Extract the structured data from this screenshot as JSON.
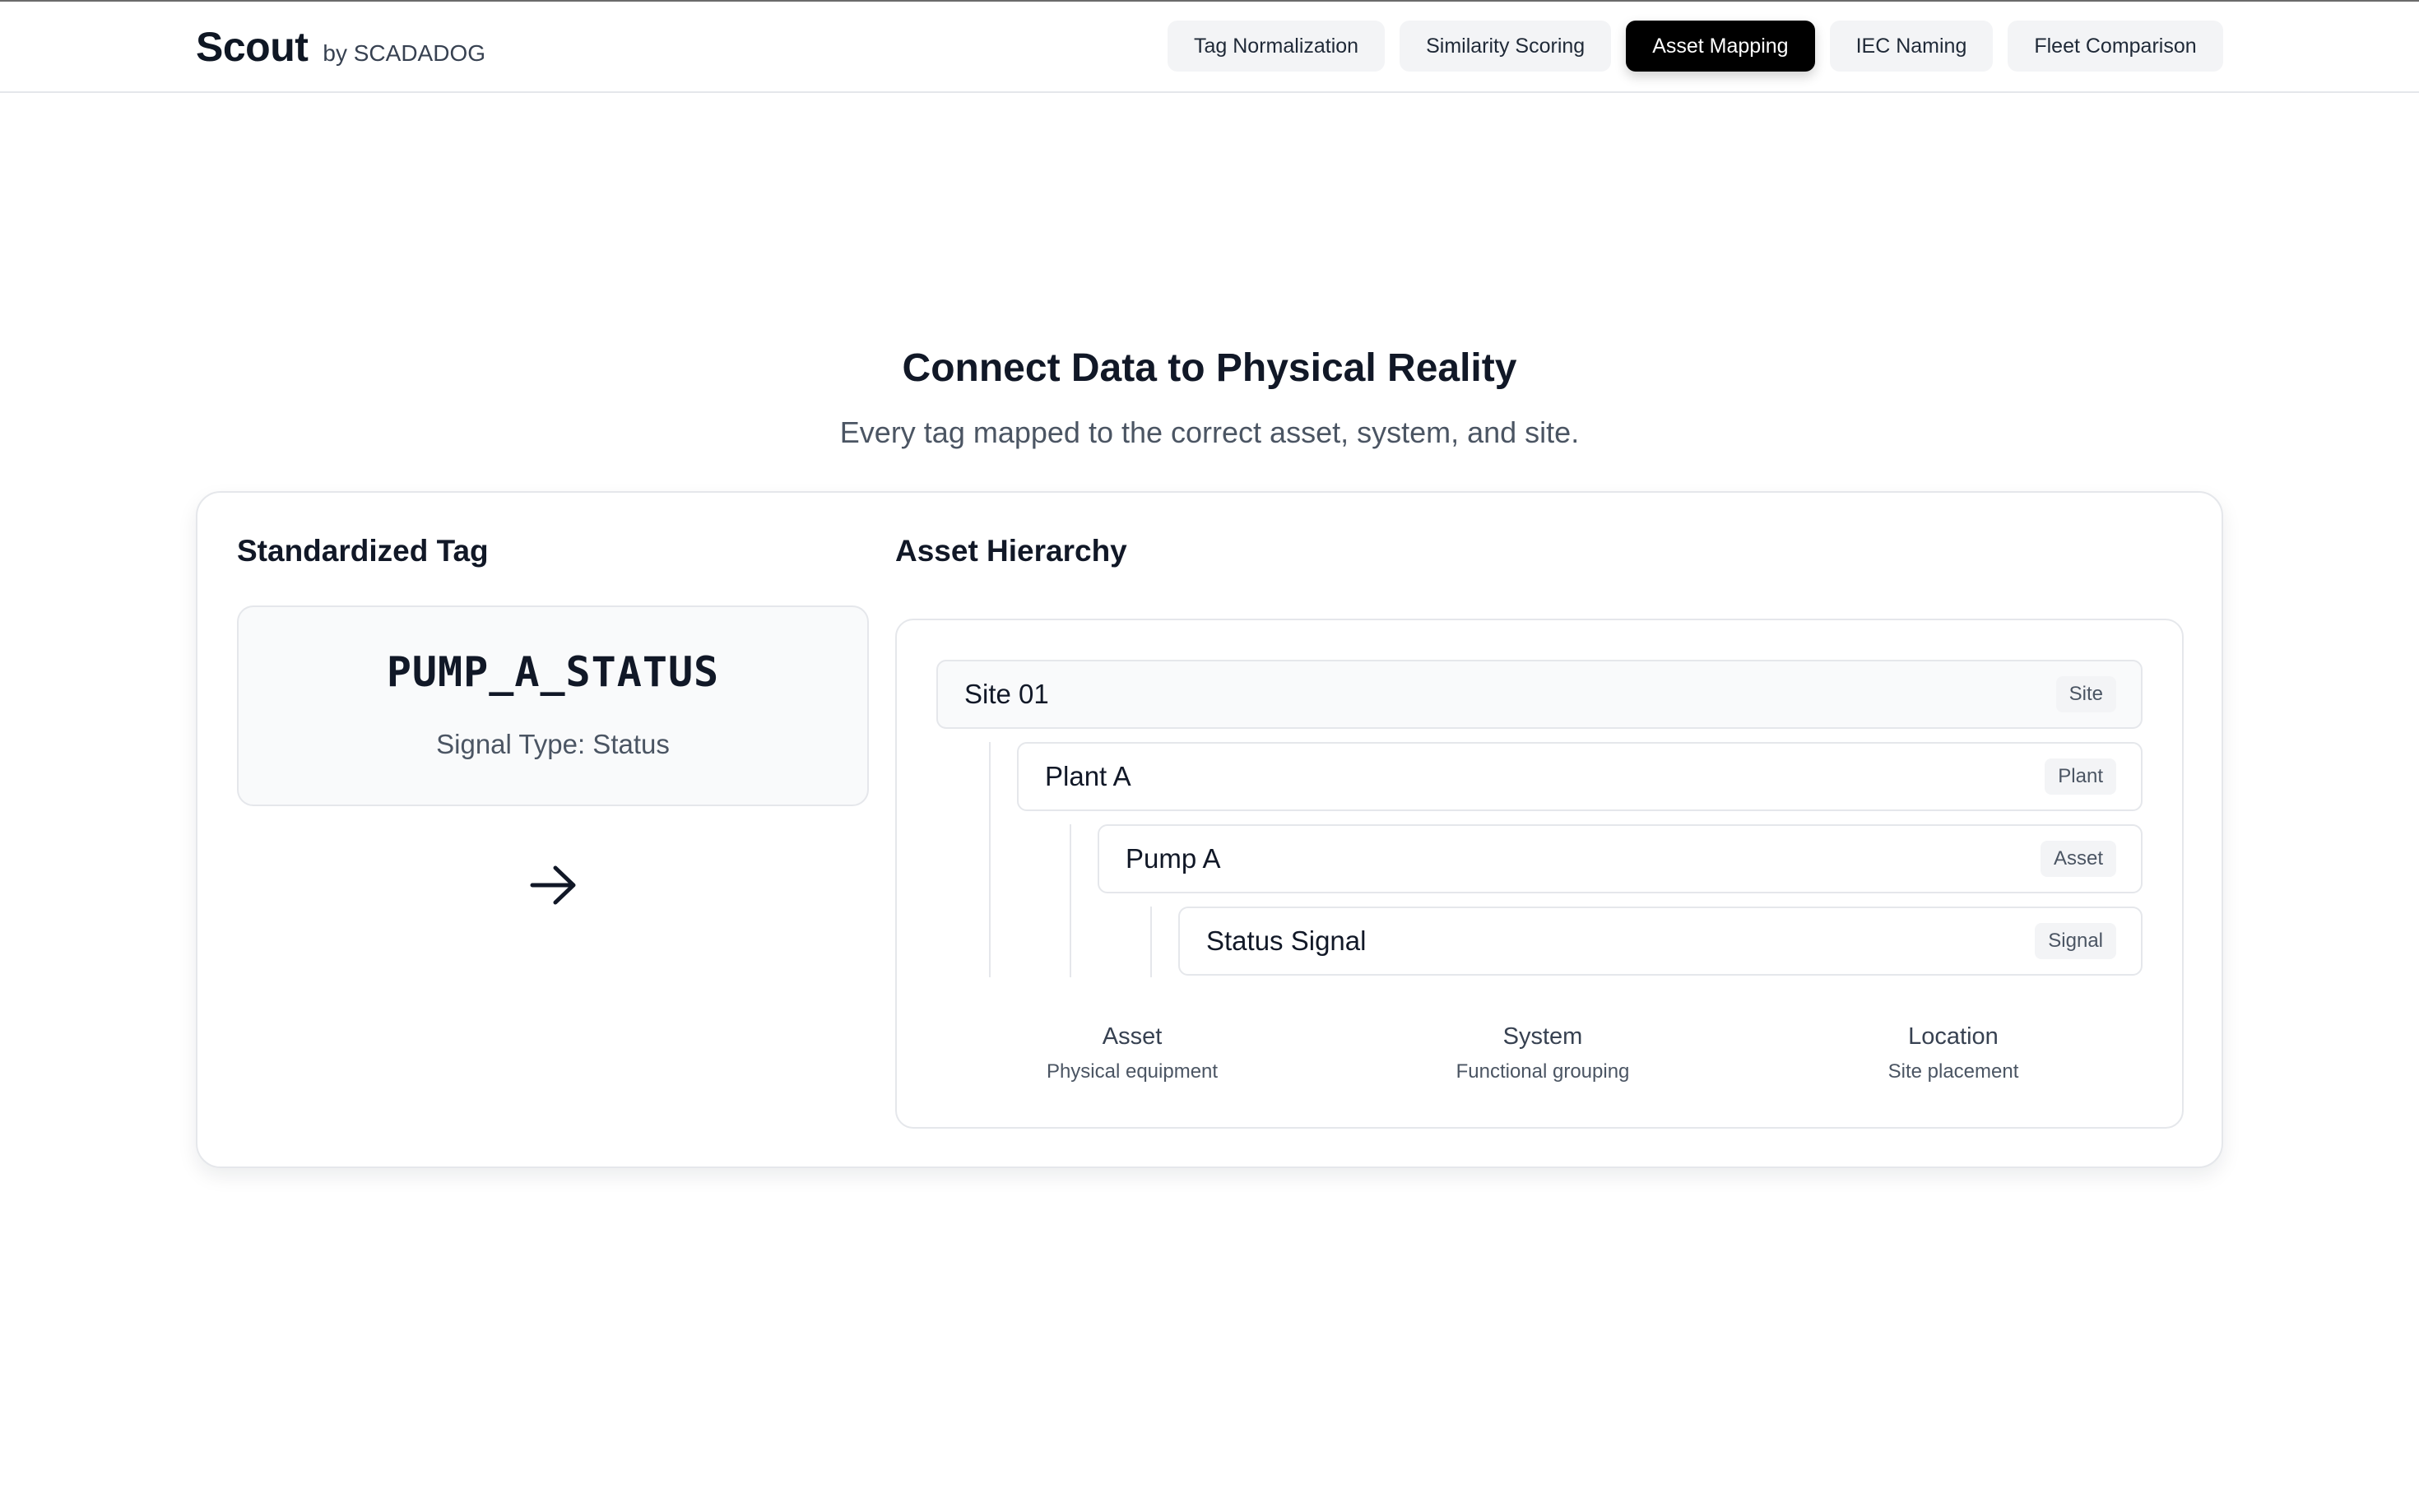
{
  "header": {
    "brand": "Scout",
    "brand_by": "by SCADADOG",
    "nav": [
      {
        "label": "Tag Normalization",
        "active": false
      },
      {
        "label": "Similarity Scoring",
        "active": false
      },
      {
        "label": "Asset Mapping",
        "active": true
      },
      {
        "label": "IEC Naming",
        "active": false
      },
      {
        "label": "Fleet Comparison",
        "active": false
      }
    ]
  },
  "hero": {
    "title": "Connect Data to Physical Reality",
    "subtitle": "Every tag mapped to the correct asset, system, and site."
  },
  "standardized_tag": {
    "heading": "Standardized Tag",
    "code": "PUMP_A_STATUS",
    "signal_type": "Signal Type: Status",
    "arrow_icon": "arrow-right-icon"
  },
  "asset_hierarchy": {
    "heading": "Asset Hierarchy",
    "nodes": [
      {
        "label": "Site 01",
        "badge": "Site"
      },
      {
        "label": "Plant A",
        "badge": "Plant"
      },
      {
        "label": "Pump A",
        "badge": "Asset"
      },
      {
        "label": "Status Signal",
        "badge": "Signal"
      }
    ],
    "legend": [
      {
        "title": "Asset",
        "desc": "Physical equipment"
      },
      {
        "title": "System",
        "desc": "Functional grouping"
      },
      {
        "title": "Location",
        "desc": "Site placement"
      }
    ]
  },
  "colors": {
    "active_tab_bg": "#000000",
    "tab_bg": "#f3f4f6",
    "card_border": "#e5e7eb",
    "text_primary": "#111827"
  }
}
